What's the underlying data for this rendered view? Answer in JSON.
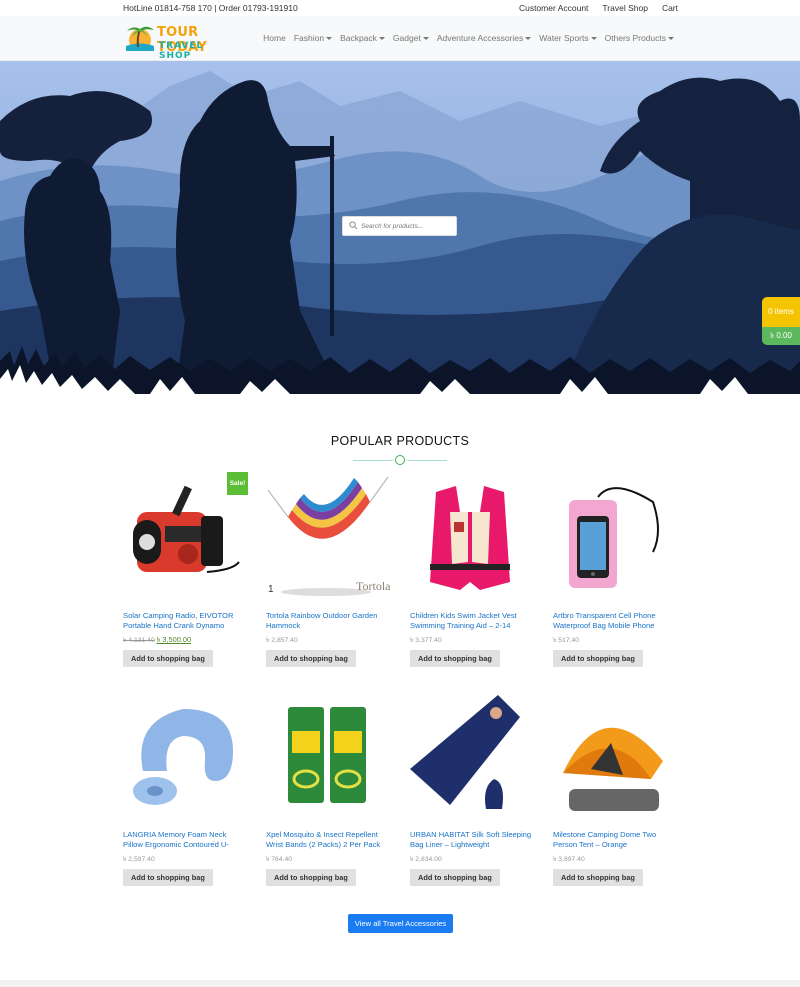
{
  "topbar": {
    "hotline": "HotLine 01814-758 170 | Order 01793-191910",
    "links": [
      {
        "first": "C",
        "rest": "ustomer Account"
      },
      {
        "first": "T",
        "rest": "ravel Shop"
      },
      {
        "first": "C",
        "rest": "art"
      }
    ]
  },
  "logo": {
    "line1": "TOUR TODAY",
    "line2": "TRAVEL SHOP"
  },
  "nav": [
    {
      "label": "Home",
      "dropdown": false
    },
    {
      "label": "Fashion",
      "dropdown": true
    },
    {
      "label": "Backpack",
      "dropdown": true
    },
    {
      "label": "Gadget",
      "dropdown": true
    },
    {
      "label": "Adventure Accessories",
      "dropdown": true
    },
    {
      "label": "Water Sports",
      "dropdown": true
    },
    {
      "label": "Others Products",
      "dropdown": true
    }
  ],
  "search": {
    "placeholder": "Search for products..."
  },
  "cart_widget": {
    "items": "0 items",
    "total": "৳ 0.00"
  },
  "section": {
    "title": "POPULAR PRODUCTS"
  },
  "products": [
    {
      "name": "Solar Camping Radio, EIVOTOR Portable Hand Crank Dynamo",
      "old_price": "৳ 4,131.40",
      "price": "৳ 3,500.00",
      "sale_badge": "Sale!",
      "button": "Add to shopping bag",
      "icon": "hand-crank-radio-image"
    },
    {
      "name": "Tortola Rainbow Outdoor Garden Hammock",
      "price": "৳ 2,857.40",
      "button": "Add to shopping bag",
      "icon": "hammock-image",
      "brand_text": "Tortola"
    },
    {
      "name": "Children Kids Swim Jacket Vest Swimming Training Aid – 2-14",
      "price": "৳ 3,377.40",
      "button": "Add to shopping bag",
      "icon": "life-jacket-image"
    },
    {
      "name": "Artbro Transparent Cell Phone Waterproof Bag Mobile Phone",
      "price": "৳ 517.40",
      "button": "Add to shopping bag",
      "icon": "waterproof-phone-bag-image"
    },
    {
      "name": "LANGRIA Memory Foam Neck Pillow Ergonomic Contoured U-",
      "price": "৳ 2,597.40",
      "button": "Add to shopping bag",
      "icon": "neck-pillow-image"
    },
    {
      "name": "Xpel Mosquito & Insect Repellent Wrist Bands (2 Packs) 2 Per Pack",
      "price": "৳ 764.40",
      "button": "Add to shopping bag",
      "icon": "mosquito-wristband-image"
    },
    {
      "name": "URBAN HABITAT Silk Soft Sleeping Bag Liner – Lightweight",
      "price": "৳ 2,834.00",
      "button": "Add to shopping bag",
      "icon": "sleeping-bag-liner-image"
    },
    {
      "name": "Milestone Camping Dome Two Person Tent – Orange",
      "price": "৳ 3,897.40",
      "button": "Add to shopping bag",
      "icon": "dome-tent-image"
    }
  ],
  "view_all": "View all Travel Accessories",
  "colors": {
    "accent": "#1a7cf0",
    "sale": "#5cbe37",
    "cart_items": "#f5c400",
    "cart_total": "#5cb85c",
    "hero_sky": "#9ab4e0"
  }
}
